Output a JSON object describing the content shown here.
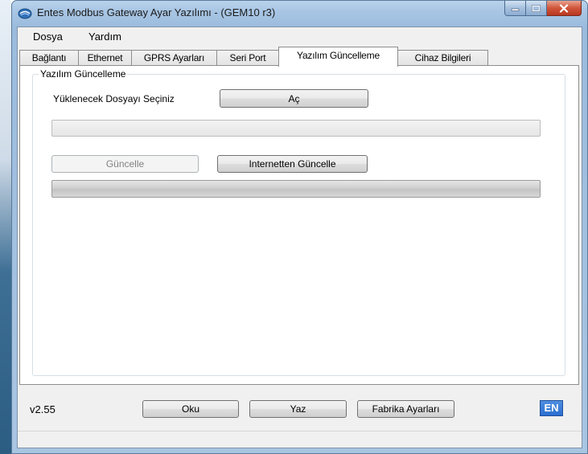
{
  "window": {
    "title": "Entes Modbus Gateway Ayar Yazılımı - (GEM10 r3)",
    "icon": "app-logo-icon",
    "caption_buttons": [
      "minimize-icon",
      "maximize-icon",
      "close-icon"
    ]
  },
  "menu": {
    "items": [
      "Dosya",
      "Yardım"
    ]
  },
  "tabs": [
    {
      "label": "Bağlantı",
      "active": false
    },
    {
      "label": "Ethernet",
      "active": false
    },
    {
      "label": "GPRS Ayarları",
      "active": false
    },
    {
      "label": "Seri Port",
      "active": false
    },
    {
      "label": "Yazılım Güncelleme",
      "active": true
    },
    {
      "label": "Cihaz Bilgileri",
      "active": false
    }
  ],
  "update_group": {
    "title": "Yazılım Güncelleme",
    "select_file_label": "Yüklenecek Dosyayı Seçiniz",
    "open_button": "Aç",
    "update_button": "Güncelle",
    "update_button_enabled": false,
    "internet_update_button": "Internetten Güncelle",
    "file_progress": 0,
    "update_progress": 0
  },
  "footer": {
    "version": "v2.55",
    "read_button": "Oku",
    "write_button": "Yaz",
    "factory_button": "Fabrika Ayarları",
    "language_badge": "EN"
  },
  "colors": {
    "title_bar": "#a9c6e4",
    "close_button": "#d0553a",
    "language_badge": "#2a6fd0"
  }
}
